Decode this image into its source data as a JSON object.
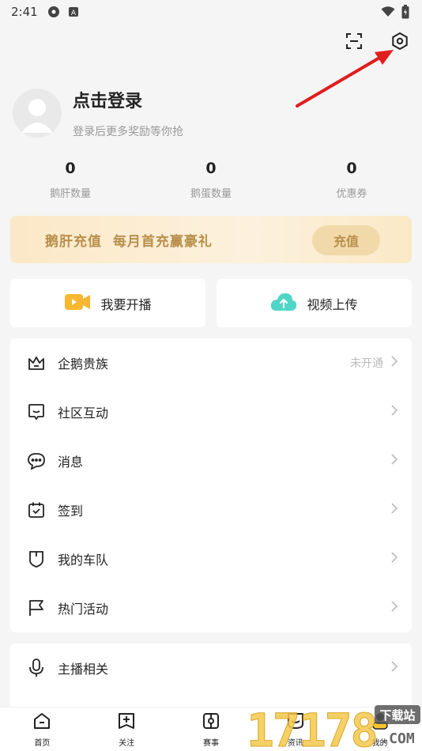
{
  "status": {
    "time": "2:41"
  },
  "profile": {
    "title": "点击登录",
    "subtitle": "登录后更多奖励等你抢"
  },
  "stats": [
    {
      "value": "0",
      "label": "鹅肝数量"
    },
    {
      "value": "0",
      "label": "鹅蛋数量"
    },
    {
      "value": "0",
      "label": "优惠券"
    }
  ],
  "banner": {
    "text": "鹅肝充值  每月首充赢豪礼",
    "button": "充值"
  },
  "actions": [
    {
      "label": "我要开播",
      "icon": "video-camera-icon"
    },
    {
      "label": "视频上传",
      "icon": "cloud-upload-icon"
    }
  ],
  "menu": [
    {
      "label": "企鹅贵族",
      "status": "未开通",
      "icon": "crown-icon"
    },
    {
      "label": "社区互动",
      "status": "",
      "icon": "chat-smile-icon"
    },
    {
      "label": "消息",
      "status": "",
      "icon": "message-icon"
    },
    {
      "label": "签到",
      "status": "",
      "icon": "calendar-check-icon"
    },
    {
      "label": "我的车队",
      "status": "",
      "icon": "shield-icon"
    },
    {
      "label": "热门活动",
      "status": "",
      "icon": "flag-icon"
    }
  ],
  "menu2": [
    {
      "label": "主播相关",
      "icon": "microphone-icon"
    }
  ],
  "nav": [
    {
      "label": "首页",
      "icon": "home-icon"
    },
    {
      "label": "关注",
      "icon": "follow-icon"
    },
    {
      "label": "赛事",
      "icon": "match-icon"
    },
    {
      "label": "资讯",
      "icon": "news-icon"
    },
    {
      "label": "我的",
      "icon": "profile-icon"
    }
  ],
  "watermark": {
    "text": "17178",
    "badge": "下载站",
    "suffix": ".COM"
  },
  "colors": {
    "gold": "#b88f4b",
    "bannerBg": "#fbe8c7",
    "arrow": "#e11d1d"
  }
}
